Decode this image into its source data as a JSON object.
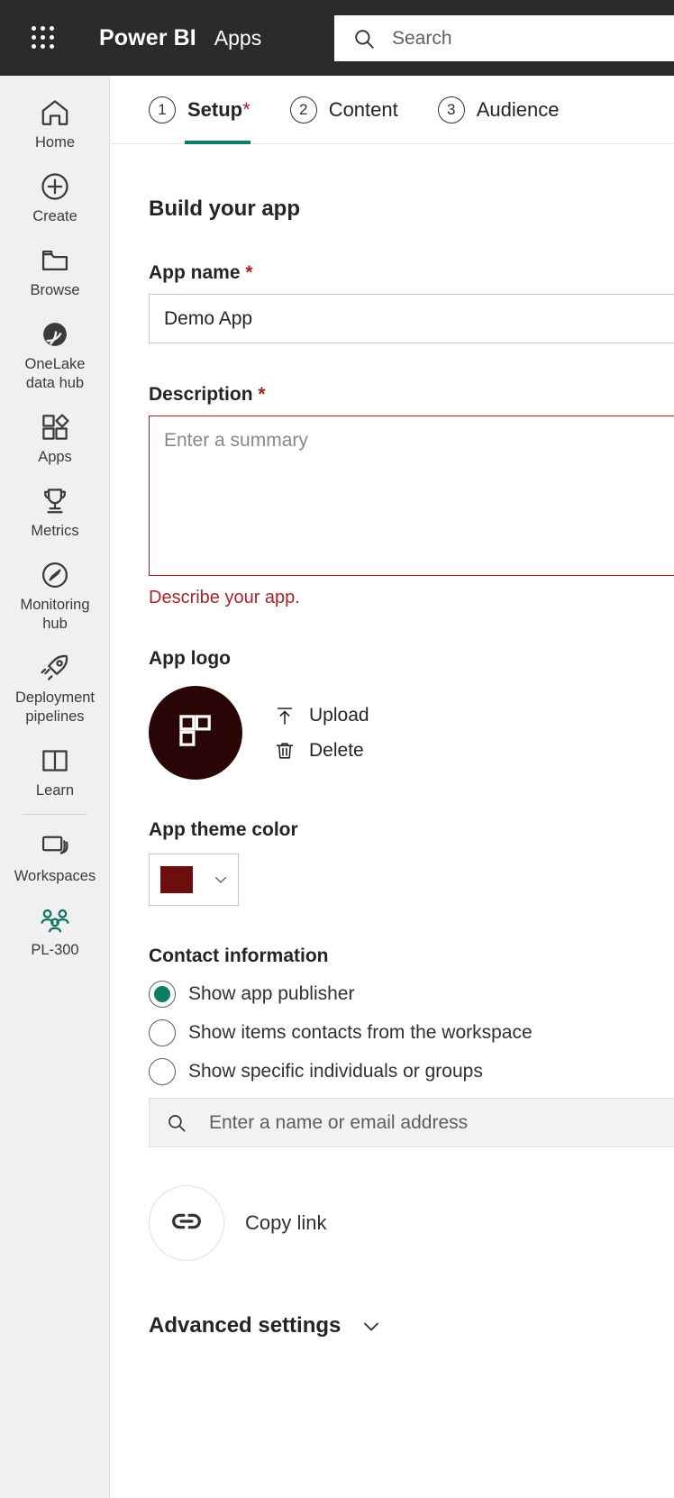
{
  "topbar": {
    "waffle_icon": "grid-waffle-icon",
    "brand": "Power BI",
    "section": "Apps",
    "search": {
      "icon": "search-icon",
      "placeholder": "Search"
    }
  },
  "sidebar": {
    "items": [
      {
        "id": "home",
        "label": "Home",
        "icon": "home-icon",
        "accent": false
      },
      {
        "id": "create",
        "label": "Create",
        "icon": "plus-circle-icon",
        "accent": false
      },
      {
        "id": "browse",
        "label": "Browse",
        "icon": "folder-icon",
        "accent": false
      },
      {
        "id": "onelake",
        "label": "OneLake\ndata hub",
        "icon": "onelake-icon",
        "accent": false
      },
      {
        "id": "apps",
        "label": "Apps",
        "icon": "apps-grid-icon",
        "accent": false
      },
      {
        "id": "metrics",
        "label": "Metrics",
        "icon": "trophy-icon",
        "accent": false
      },
      {
        "id": "monitoring",
        "label": "Monitoring\nhub",
        "icon": "compass-icon",
        "accent": false
      },
      {
        "id": "deployment",
        "label": "Deployment\npipelines",
        "icon": "rocket-icon",
        "accent": false
      },
      {
        "id": "learn",
        "label": "Learn",
        "icon": "book-icon",
        "accent": false
      },
      {
        "id": "workspaces",
        "label": "Workspaces",
        "icon": "workspaces-stack-icon",
        "accent": false
      },
      {
        "id": "pl300",
        "label": "PL-300",
        "icon": "people-group-icon",
        "accent": true
      }
    ],
    "divider_after": "learn"
  },
  "steps": [
    {
      "num": "1",
      "label": "Setup",
      "required": "*",
      "active": true
    },
    {
      "num": "2",
      "label": "Content",
      "required": "",
      "active": false
    },
    {
      "num": "3",
      "label": "Audience",
      "required": "",
      "active": false
    }
  ],
  "main": {
    "page_title": "Build your app",
    "app_name": {
      "label": "App name",
      "required": "*",
      "value": "Demo App"
    },
    "description": {
      "label": "Description",
      "required": "*",
      "placeholder": "Enter a summary",
      "error": "Describe your app."
    },
    "app_logo": {
      "label": "App logo",
      "logo_icon": "fabric-grid-logo-icon",
      "logo_bg": "#2a0505",
      "upload": {
        "label": "Upload",
        "icon": "upload-arrow-icon"
      },
      "delete": {
        "label": "Delete",
        "icon": "trash-icon"
      }
    },
    "theme_color": {
      "label": "App theme color",
      "value": "#6e0d0d",
      "chevron_icon": "chevron-down-icon"
    },
    "contact": {
      "label": "Contact information",
      "options": [
        {
          "id": "publisher",
          "label": "Show app publisher",
          "selected": true
        },
        {
          "id": "items",
          "label": "Show items contacts from the workspace",
          "selected": false
        },
        {
          "id": "specific",
          "label": "Show specific individuals or groups",
          "selected": false
        }
      ],
      "people_picker": {
        "icon": "search-icon",
        "placeholder": "Enter a name or email address"
      }
    },
    "copy_link": {
      "label": "Copy link",
      "icon": "link-icon"
    },
    "advanced": {
      "label": "Advanced settings",
      "chevron_icon": "chevron-down-icon"
    }
  },
  "colors": {
    "accent_teal": "#107c63",
    "error_red": "#a4262c",
    "topbar_bg": "#2b2b2b",
    "sidebar_bg": "#f0f0f0"
  }
}
